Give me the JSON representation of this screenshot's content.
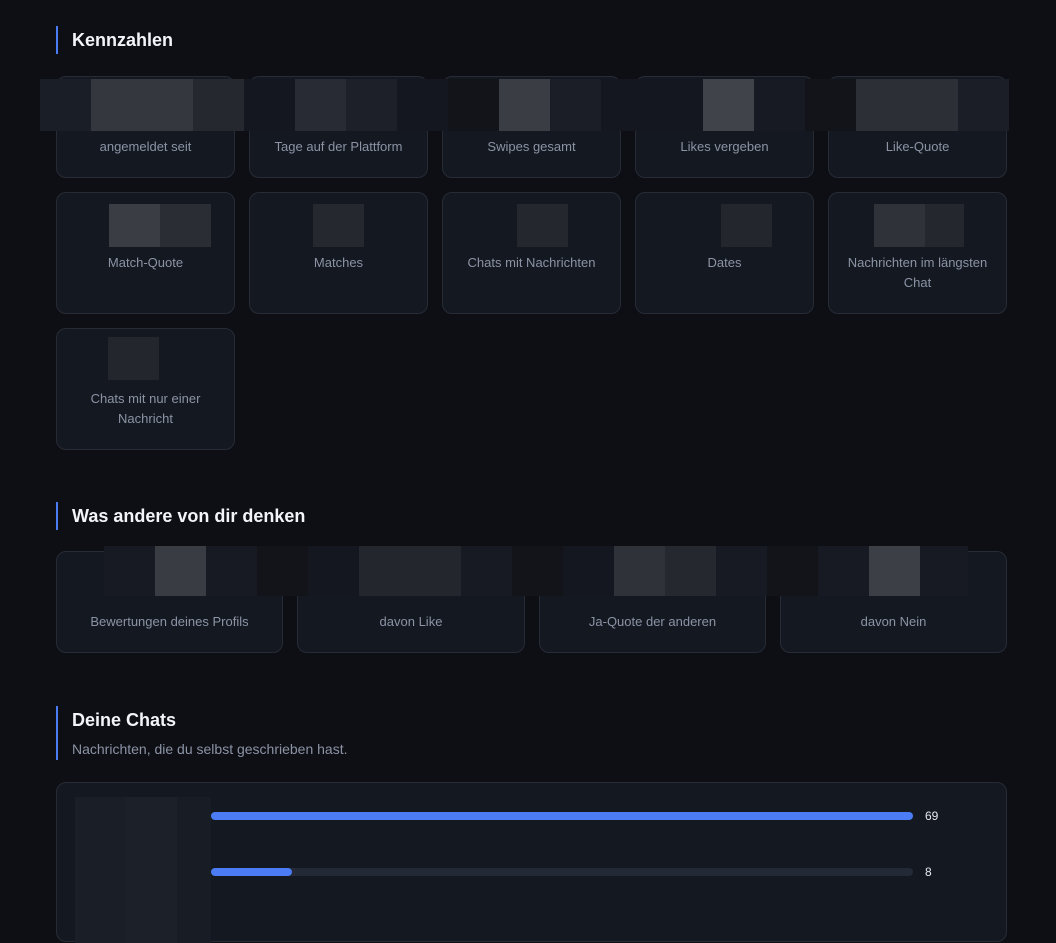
{
  "kennzahlen": {
    "title": "Kennzahlen",
    "cards": [
      {
        "label": "angemeldet seit"
      },
      {
        "label": "Tage auf der Plattform"
      },
      {
        "label": "Swipes gesamt"
      },
      {
        "label": "Likes vergeben"
      },
      {
        "label": "Like-Quote"
      },
      {
        "label": "Match-Quote"
      },
      {
        "label": "Matches"
      },
      {
        "label": "Chats mit Nachrichten"
      },
      {
        "label": "Dates"
      },
      {
        "label": "Nachrichten im längsten Chat"
      },
      {
        "label": "Chats mit nur einer Nachricht"
      }
    ]
  },
  "meinungen": {
    "title": "Was andere von dir denken",
    "cards": [
      {
        "label": "Bewertungen deines Profils"
      },
      {
        "label": "davon Like"
      },
      {
        "label": "Ja-Quote der anderen"
      },
      {
        "label": "davon Nein"
      }
    ]
  },
  "chats": {
    "title": "Deine Chats",
    "subtitle": "Nachrichten, die du selbst geschrieben hast.",
    "accent_color": "#4b7bf5"
  },
  "chart_data": {
    "type": "bar",
    "orientation": "horizontal",
    "values": [
      69,
      8
    ],
    "data_labels": [
      "69",
      "8"
    ],
    "xlim": [
      0,
      69
    ]
  }
}
